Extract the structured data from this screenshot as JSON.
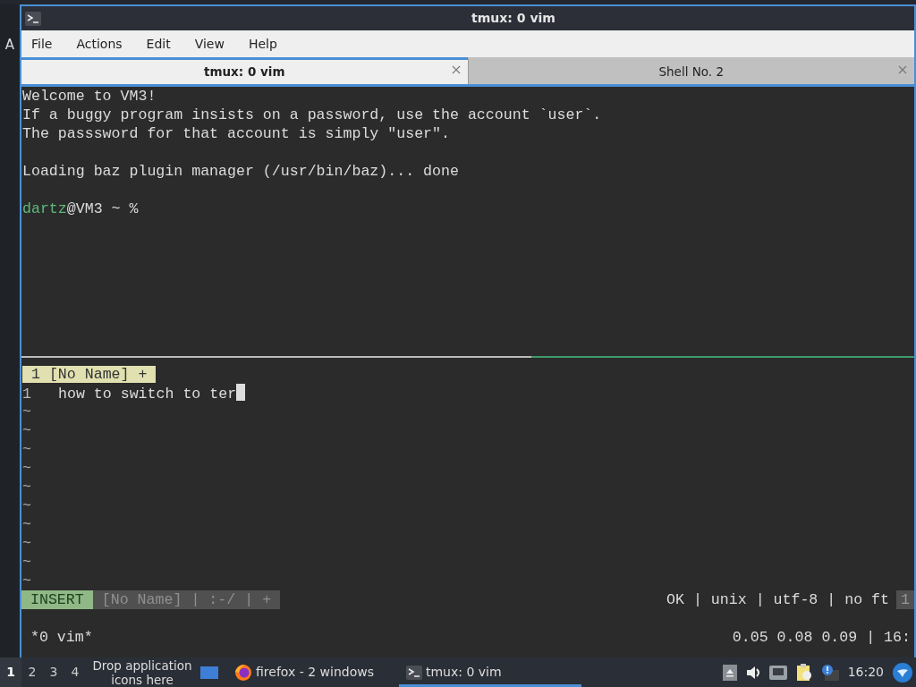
{
  "background_window": {
    "letter": "A"
  },
  "window": {
    "title": "tmux: 0 vim",
    "menu": [
      "File",
      "Actions",
      "Edit",
      "View",
      "Help"
    ],
    "tabs": [
      {
        "label": "tmux: 0 vim",
        "selected": true
      },
      {
        "label": "Shell No. 2",
        "selected": false
      }
    ],
    "terminal": {
      "lines": [
        {
          "kind": "text",
          "text": "Welcome to VM3!"
        },
        {
          "kind": "text",
          "text": "If a buggy program insists on a password, use the account `user`."
        },
        {
          "kind": "text",
          "text": "The passsword for that account is simply \"user\"."
        },
        {
          "kind": "blank"
        },
        {
          "kind": "text",
          "text": "Loading baz plugin manager (/usr/bin/baz)... done"
        },
        {
          "kind": "blank"
        }
      ],
      "prompt": {
        "user": "dartz",
        "rest": "@VM3 ~ %"
      },
      "vim": {
        "tabline": "1 [No Name] +",
        "buffer": [
          {
            "number": "1",
            "text": "how to switch to ter"
          }
        ],
        "tildes": [
          "~",
          "~",
          "~",
          "~",
          "~",
          "~",
          "~",
          "~",
          "~",
          "~"
        ],
        "mode": "INSERT",
        "status_segments": [
          "[No Name]",
          "|",
          ":-/",
          "|",
          "+"
        ],
        "status_right": "OK | unix | utf-8 | no ft",
        "status_cut": "1"
      },
      "tmux_status": {
        "left": "*0 vim*",
        "right": "0.05 0.08 0.09 | 16:"
      }
    }
  },
  "taskbar": {
    "workspaces": [
      {
        "label": "1",
        "selected": true
      },
      {
        "label": "2",
        "selected": false
      },
      {
        "label": "3",
        "selected": false
      },
      {
        "label": "4",
        "selected": false
      }
    ],
    "launcher_hint": "Drop application icons here",
    "tasks": [
      {
        "kind": "browser",
        "label": "firefox - 2 windows",
        "selected": false
      },
      {
        "kind": "terminal",
        "label": "tmux: 0 vim",
        "selected": true
      }
    ],
    "clock": "16:20"
  }
}
